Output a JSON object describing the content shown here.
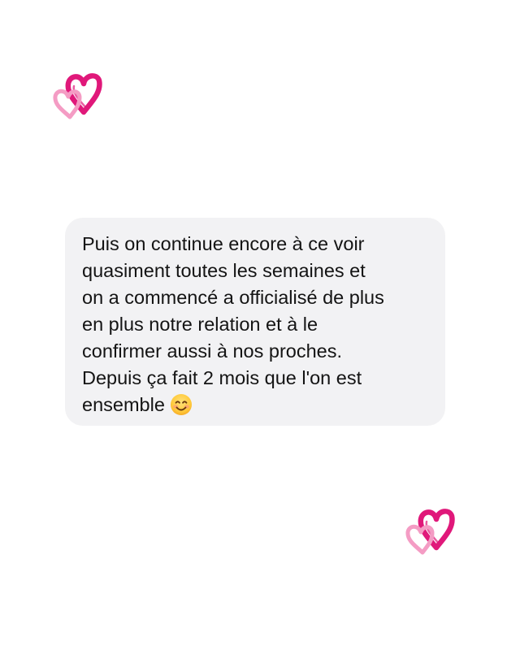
{
  "message": {
    "text": "Puis on continue encore à ce voir\nquasiment toutes les semaines et\non a commencé a officialisé de plus\nen plus notre relation et à le\nconfirmer aussi à nos proches.\nDepuis ça fait 2 mois que l'on est\nensemble",
    "emoji": "smiling-face-icon"
  },
  "decorations": {
    "hearts_icon": "double-hearts-icon",
    "dark_pink": "#e0187a",
    "light_pink": "#f49cc4"
  },
  "colors": {
    "background": "#ffffff",
    "bubble": "#f2f2f4",
    "text": "#141414"
  }
}
